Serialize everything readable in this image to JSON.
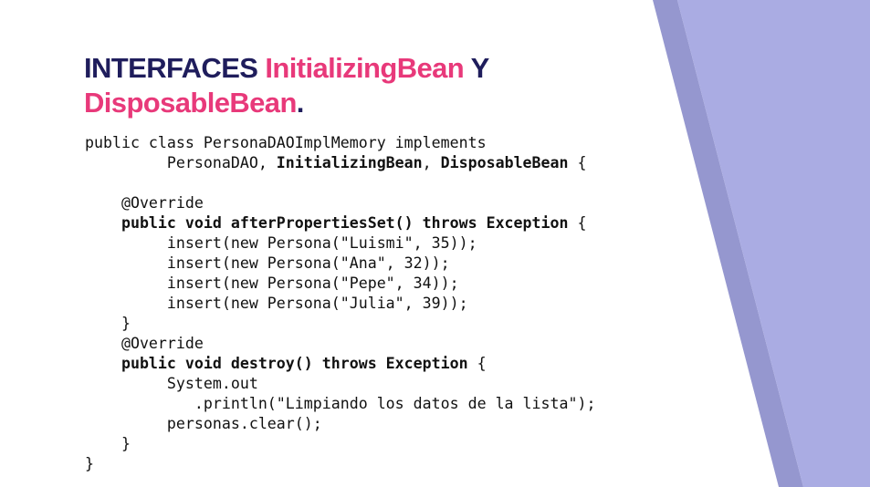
{
  "title": {
    "part1": "INTERFACES ",
    "part2": "InitializingBean",
    "part3": " Y",
    "part4": "DisposableBean",
    "part5": "."
  },
  "code": {
    "l1": "public class PersonaDAOImplMemory implements",
    "l2_pre": "         PersonaDAO, ",
    "l2_b1": "InitializingBean",
    "l2_mid": ", ",
    "l2_b2": "DisposableBean",
    "l2_post": " {",
    "l3": "",
    "l4": "    @Override",
    "l5": "    public void afterPropertiesSet() throws Exception",
    "l5_post": " {",
    "l6": "         insert(new Persona(\"Luismi\", 35));",
    "l7": "         insert(new Persona(\"Ana\", 32));",
    "l8": "         insert(new Persona(\"Pepe\", 34));",
    "l9": "         insert(new Persona(\"Julia\", 39));",
    "l10": "    }",
    "l11": "    @Override",
    "l12": "    public void destroy() throws Exception",
    "l12_post": " {",
    "l13": "         System.out",
    "l14": "            .println(\"Limpiando los datos de la lista\");",
    "l15": "         personas.clear();",
    "l16": "    }",
    "l17": "}"
  },
  "colors": {
    "title_dark": "#1f1d5c",
    "title_pink": "#e8397a",
    "deco_light": "#aaace3",
    "deco_dark": "#9597cf"
  }
}
